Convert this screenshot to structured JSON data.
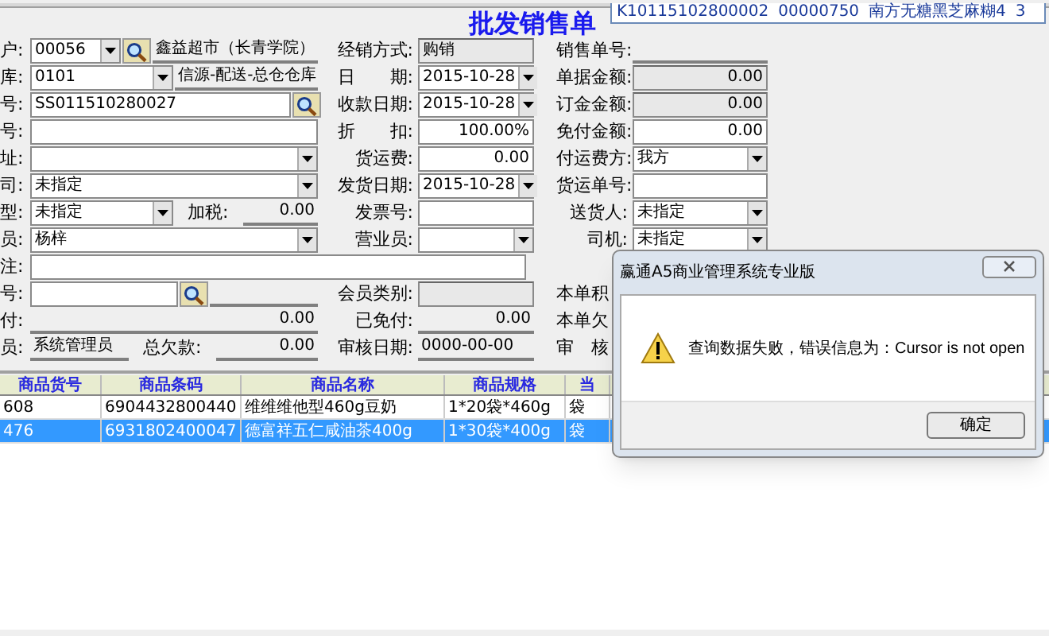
{
  "popup_list": {
    "cells": [
      "K10115102800002",
      "00000750",
      "南方无糖黑芝麻糊4",
      "3"
    ]
  },
  "title": "批发销售单",
  "form_rows": [
    {
      "left": [
        {
          "kind": "label",
          "text": "户:"
        },
        {
          "kind": "combo",
          "value": "00056"
        },
        {
          "kind": "search"
        },
        {
          "kind": "underline_text",
          "value": "鑫益超市（长青学院）"
        }
      ],
      "middle": [
        {
          "kind": "label",
          "text": "经销方式:"
        },
        {
          "kind": "readonly_text",
          "value": "购销"
        }
      ],
      "right": [
        {
          "kind": "label",
          "text": "销售单号:"
        },
        {
          "kind": "underline_text"
        }
      ]
    },
    {
      "left": [
        {
          "kind": "label",
          "text": "库:"
        },
        {
          "kind": "combo",
          "value": "0101"
        },
        {
          "kind": "underline_text",
          "value": "信源-配送-总仓仓库"
        }
      ],
      "middle": [
        {
          "kind": "label",
          "text": "日　　期:"
        },
        {
          "kind": "combo",
          "value": "2015-10-28"
        }
      ],
      "right": [
        {
          "kind": "label",
          "text": "单据金额:"
        },
        {
          "kind": "readonly_number",
          "value": "0.00"
        }
      ]
    },
    {
      "left": [
        {
          "kind": "label",
          "text": "号:"
        },
        {
          "kind": "text_field",
          "value": "SS011510280027"
        },
        {
          "kind": "search"
        }
      ],
      "middle": [
        {
          "kind": "label",
          "text": "收款日期:"
        },
        {
          "kind": "combo",
          "value": "2015-10-28"
        }
      ],
      "right": [
        {
          "kind": "label",
          "text": "订金金额:"
        },
        {
          "kind": "readonly_number",
          "value": "0.00"
        }
      ]
    },
    {
      "left": [
        {
          "kind": "label",
          "text": "号:"
        },
        {
          "kind": "text_field"
        }
      ],
      "middle": [
        {
          "kind": "label",
          "text": "折　　扣:"
        },
        {
          "kind": "number_field",
          "value": "100.00%"
        }
      ],
      "right": [
        {
          "kind": "label",
          "text": "免付金额:"
        },
        {
          "kind": "number_field",
          "value": "0.00"
        }
      ]
    },
    {
      "left": [
        {
          "kind": "label",
          "text": "址:"
        },
        {
          "kind": "combo"
        }
      ],
      "middle": [
        {
          "kind": "label",
          "text": "货运费:"
        },
        {
          "kind": "number_field",
          "value": "0.00"
        }
      ],
      "right": [
        {
          "kind": "label",
          "text": "付运费方:"
        },
        {
          "kind": "combo",
          "value": "我方"
        }
      ]
    },
    {
      "left": [
        {
          "kind": "label",
          "text": "司:"
        },
        {
          "kind": "combo",
          "value": "未指定"
        }
      ],
      "middle": [
        {
          "kind": "label",
          "text": "发货日期:"
        },
        {
          "kind": "combo",
          "value": "2015-10-28"
        }
      ],
      "right": [
        {
          "kind": "label",
          "text": "货运单号:"
        },
        {
          "kind": "text_field"
        }
      ]
    },
    {
      "left": [
        {
          "kind": "label",
          "text": "型:"
        },
        {
          "kind": "combo",
          "value": "未指定"
        },
        {
          "kind": "label",
          "text": "加税:"
        },
        {
          "kind": "underline_number",
          "value": "0.00"
        }
      ],
      "middle": [
        {
          "kind": "label",
          "text": "发票号:"
        },
        {
          "kind": "text_field"
        }
      ],
      "right": [
        {
          "kind": "label",
          "text": "送货人:"
        },
        {
          "kind": "combo",
          "value": "未指定"
        }
      ]
    },
    {
      "left": [
        {
          "kind": "label",
          "text": "员:"
        },
        {
          "kind": "combo",
          "value": "杨梓"
        }
      ],
      "middle": [
        {
          "kind": "label",
          "text": "营业员:"
        },
        {
          "kind": "combo"
        }
      ],
      "right": [
        {
          "kind": "label",
          "text": "司机:"
        },
        {
          "kind": "combo",
          "value": "未指定"
        }
      ]
    },
    {
      "left": [
        {
          "kind": "label",
          "text": "注:"
        },
        {
          "kind": "wide_field"
        }
      ],
      "middle": [],
      "right": []
    },
    {
      "left": [
        {
          "kind": "label",
          "text": "号:"
        },
        {
          "kind": "text_field"
        },
        {
          "kind": "search"
        },
        {
          "kind": "underline_text"
        }
      ],
      "middle": [
        {
          "kind": "label",
          "text": "会员类别:"
        },
        {
          "kind": "readonly_text"
        }
      ],
      "right": [
        {
          "kind": "label",
          "text": "本单积"
        }
      ]
    },
    {
      "left": [
        {
          "kind": "label",
          "text": "付:"
        },
        {
          "kind": "underline_number",
          "value": "0.00"
        }
      ],
      "middle": [
        {
          "kind": "label",
          "text": "已免付:"
        },
        {
          "kind": "underline_number",
          "value": "0.00"
        }
      ],
      "right": [
        {
          "kind": "label",
          "text": "本单欠"
        }
      ]
    },
    {
      "left": [
        {
          "kind": "label",
          "text": "员:"
        },
        {
          "kind": "underline_text",
          "value": "系统管理员"
        },
        {
          "kind": "label",
          "text": "总欠款:"
        },
        {
          "kind": "underline_number",
          "value": "0.00"
        }
      ],
      "middle": [
        {
          "kind": "label",
          "text": "审核日期:"
        },
        {
          "kind": "underline_text",
          "value": "0000-00-00"
        }
      ],
      "right": [
        {
          "kind": "label",
          "text": "审　核"
        }
      ]
    }
  ],
  "table": {
    "columns": [
      "商品货号",
      "商品条码",
      "商品名称",
      "商品规格",
      "当"
    ],
    "rows": [
      {
        "cells": [
          "608",
          "6904432800440",
          "维维维他型460g豆奶",
          "1*20袋*460g",
          "袋"
        ],
        "selected": false
      },
      {
        "cells": [
          "476",
          "6931802400047",
          "德富祥五仁咸油茶400g",
          "1*30袋*400g",
          "袋"
        ],
        "selected": true
      }
    ]
  },
  "dialog": {
    "title": "赢通A5商业管理系统专业版",
    "message": "查询数据失败，错误信息为：Cursor is not open",
    "button": "确定"
  }
}
